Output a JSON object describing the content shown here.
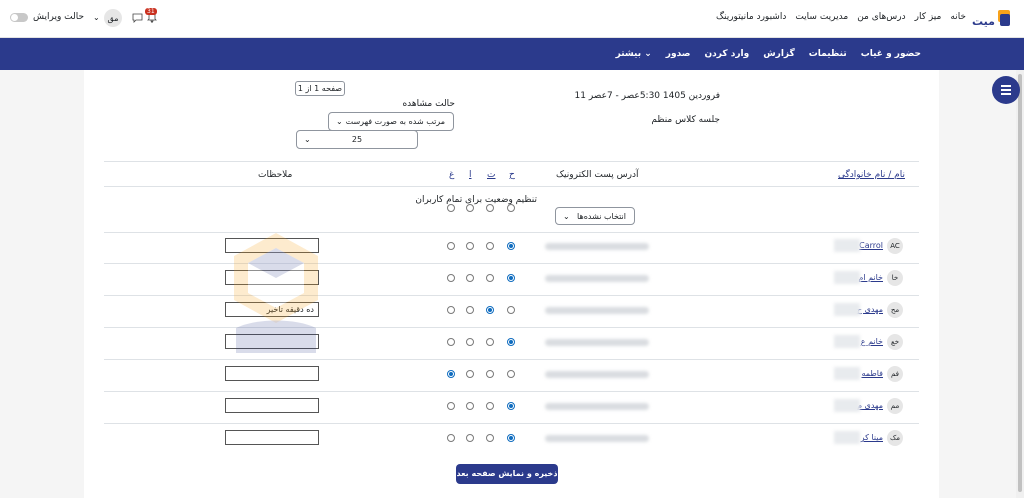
{
  "topbar": {
    "nav": [
      "خانه",
      "میز کار",
      "درس‌های من",
      "مدیریت سایت",
      "داشبورد مانیتورینگ"
    ],
    "avatar_initials": "مق",
    "notification_count": "31",
    "edit_mode_label": "حالت ویرایش"
  },
  "mainnav": {
    "items": [
      "حضور و غیاب",
      "تنظیمات",
      "گزارش",
      "وارد کردن",
      "صدور",
      "بیشتر ⌄"
    ]
  },
  "session": {
    "datetime": "11 فروردین 1405 5:30عصر - 7عصر",
    "title": "جلسه کلاس منظم",
    "page_label": "صفحه 1 از 1",
    "view_mode_label": "حالت مشاهده",
    "view_mode_value": "مرتب شده به صورت فهرست",
    "per_page_value": "25"
  },
  "table": {
    "col_name": "نام / نام خانوادگی",
    "col_email": "آدرس پست الکترونیک",
    "status_cols": [
      "ح",
      "ت",
      "ا",
      "غ"
    ],
    "col_remarks": "ملاحظات",
    "set_all_label": "تنظیم وضعیت برای تمام کاربران",
    "set_all_select": "انتخاب نشده‌ها",
    "rows": [
      {
        "initials": "AC",
        "name": "Carrol",
        "selected": 0,
        "remark": ""
      },
      {
        "initials": "خا",
        "name": "خانم ام",
        "selected": 0,
        "remark": ""
      },
      {
        "initials": "مح",
        "name": "مهدی ح",
        "selected": 1,
        "remark": "ده دقیقه تاخیر"
      },
      {
        "initials": "خع",
        "name": "خانم ع",
        "selected": 0,
        "remark": ""
      },
      {
        "initials": "فم",
        "name": "فاطمه",
        "selected": 3,
        "remark": ""
      },
      {
        "initials": "مم",
        "name": "مهدی م",
        "selected": 0,
        "remark": ""
      },
      {
        "initials": "مک",
        "name": "مینا کر",
        "selected": 0,
        "remark": ""
      }
    ]
  },
  "save_button": "ذخیره و نمایش صفحه بعد",
  "colors": {
    "primary": "#2b3a8c",
    "radio_checked": "#0f6cbf",
    "badge": "#ca3120"
  }
}
